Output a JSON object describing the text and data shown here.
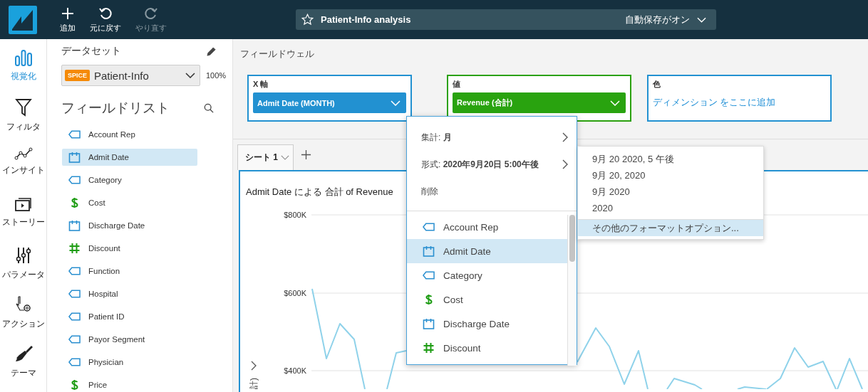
{
  "top_bar": {
    "actions": [
      {
        "label": "追加",
        "disabled": false
      },
      {
        "label": "元に戻す",
        "disabled": false
      },
      {
        "label": "やり直す",
        "disabled": true
      }
    ],
    "analysis_title": "Patient-Info analysis",
    "autosave": "自動保存がオン"
  },
  "nav": [
    {
      "label": "視覚化",
      "selected": true
    },
    {
      "label": "フィルタ",
      "selected": false
    },
    {
      "label": "インサイト",
      "selected": false
    },
    {
      "label": "ストーリー",
      "selected": false
    },
    {
      "label": "パラメータ",
      "selected": false
    },
    {
      "label": "アクション",
      "selected": false
    },
    {
      "label": "テーマ",
      "selected": false
    }
  ],
  "dataset": {
    "heading": "データセット",
    "badge": "SPICE",
    "name": "Patient-Info",
    "percent": "100%"
  },
  "field_list": {
    "heading": "フィールドリスト",
    "fields": [
      {
        "name": "Account Rep",
        "kind": "dimension",
        "selected": false
      },
      {
        "name": "Admit Date",
        "kind": "date",
        "selected": true
      },
      {
        "name": "Category",
        "kind": "dimension",
        "selected": false
      },
      {
        "name": "Cost",
        "kind": "currency",
        "selected": false
      },
      {
        "name": "Discharge Date",
        "kind": "date",
        "selected": false
      },
      {
        "name": "Discount",
        "kind": "number",
        "selected": false
      },
      {
        "name": "Function",
        "kind": "dimension",
        "selected": false
      },
      {
        "name": "Hospital",
        "kind": "dimension",
        "selected": false
      },
      {
        "name": "Patient ID",
        "kind": "dimension",
        "selected": false
      },
      {
        "name": "Payor Segment",
        "kind": "dimension",
        "selected": false
      },
      {
        "name": "Physician",
        "kind": "dimension",
        "selected": false
      },
      {
        "name": "Price",
        "kind": "currency",
        "selected": false
      }
    ]
  },
  "field_wells": {
    "title": "フィールドウェル",
    "wells": [
      {
        "label": "X 軸",
        "kind": "dimension",
        "field": "Admit Date (MONTH)"
      },
      {
        "label": "値",
        "kind": "measure",
        "field": "Revenue (合計)"
      },
      {
        "label": "色",
        "kind": "empty",
        "placeholder": "ディメンション をここに追加"
      }
    ]
  },
  "sheet_tabs": [
    {
      "label": "シート 1",
      "selected": true
    }
  ],
  "visual": {
    "title": "Admit Date による 合計 of Revenue",
    "y_axis_title": "計)",
    "y_tick_labels": [
      "$800K",
      "$600K",
      "$400K"
    ]
  },
  "field_menu": {
    "actions": [
      {
        "text": "集計: **月**",
        "has_submenu": true
      },
      {
        "text": "形式: **2020年9月20日 5:00午後**",
        "has_submenu": true
      },
      {
        "text": "削除",
        "has_submenu": false
      }
    ],
    "fields": [
      {
        "name": "Account Rep",
        "kind": "dimension",
        "selected": false
      },
      {
        "name": "Admit Date",
        "kind": "date",
        "selected": true
      },
      {
        "name": "Category",
        "kind": "dimension",
        "selected": false
      },
      {
        "name": "Cost",
        "kind": "currency",
        "selected": false
      },
      {
        "name": "Discharge Date",
        "kind": "date",
        "selected": false
      },
      {
        "name": "Discount",
        "kind": "number",
        "selected": false
      }
    ]
  },
  "format_submenu": {
    "options": [
      {
        "label": "9月 20 2020, 5 午後",
        "selected": false
      },
      {
        "label": "9月 20, 2020",
        "selected": false
      },
      {
        "label": "9月 2020",
        "selected": false
      },
      {
        "label": "2020",
        "selected": false
      },
      {
        "label": "その他のフォーマットオプション...",
        "selected": true
      }
    ]
  }
}
